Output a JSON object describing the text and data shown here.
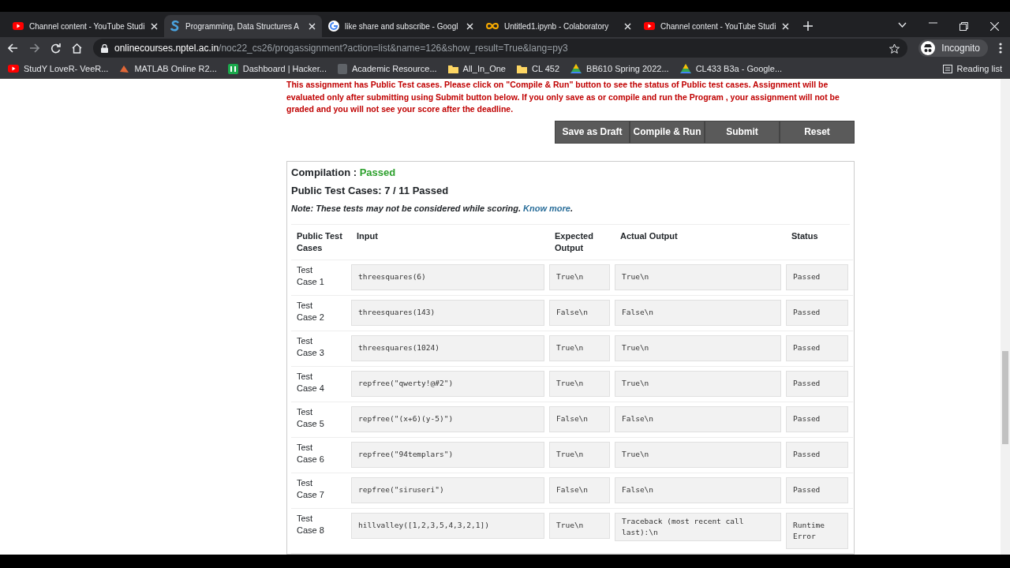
{
  "tabs": [
    {
      "kind": "youtube",
      "title": "Channel content - YouTube Studi",
      "selected": false
    },
    {
      "kind": "s",
      "title": "Programming, Data Structures A",
      "selected": true
    },
    {
      "kind": "google",
      "title": "like share and subscribe - Googl",
      "selected": false
    },
    {
      "kind": "colab",
      "title": "Untitled1.ipynb - Colaboratory",
      "selected": false
    },
    {
      "kind": "youtube",
      "title": "Channel content - YouTube Studi",
      "selected": false
    }
  ],
  "address": {
    "host": "onlinecourses.nptel.ac.in",
    "path": "/noc22_cs26/progassignment?action=list&name=126&show_result=True&lang=py3"
  },
  "profile": "Incognito",
  "bookmarks": [
    {
      "kind": "youtube",
      "label": "StudY LoveR- VeeR..."
    },
    {
      "kind": "matlab",
      "label": "MATLAB Online R2..."
    },
    {
      "kind": "hackerrank",
      "label": "Dashboard | Hacker..."
    },
    {
      "kind": "blank",
      "label": "Academic Resource..."
    },
    {
      "kind": "folder",
      "label": "All_In_One"
    },
    {
      "kind": "folder",
      "label": "CL 452"
    },
    {
      "kind": "drive",
      "label": "BB610 Spring 2022..."
    },
    {
      "kind": "drive",
      "label": "CL433 B3a - Google..."
    }
  ],
  "reading_list": "Reading list",
  "notice": "This assignment has Public Test cases. Please click on \"Compile & Run\" button to see the status of Public test cases. Assignment will be evaluated only after submitting using Submit button below. If you only save as or compile and run the Program , your assignment will not be graded and you will not see your score after the deadline.",
  "buttons": [
    "Save as Draft",
    "Compile & Run",
    "Submit",
    "Reset"
  ],
  "result": {
    "compilation_label": "Compilation :",
    "compilation_status": "Passed",
    "summary": "Public Test Cases: 7 / 11 Passed",
    "note": "Note: These tests may not be considered while scoring.",
    "note_link": "Know more",
    "note_end": "."
  },
  "table": {
    "columns": [
      "Public Test Cases",
      "Input",
      "Expected Output",
      "Actual Output",
      "Status"
    ],
    "rows": [
      {
        "case": "Test Case 1",
        "input": "threesquares(6)",
        "expected": "True\\n",
        "actual": "True\\n",
        "status": "Passed"
      },
      {
        "case": "Test Case 2",
        "input": "threesquares(143)",
        "expected": "False\\n",
        "actual": "False\\n",
        "status": "Passed"
      },
      {
        "case": "Test Case 3",
        "input": "threesquares(1024)",
        "expected": "True\\n",
        "actual": "True\\n",
        "status": "Passed"
      },
      {
        "case": "Test Case 4",
        "input": "repfree(\"qwerty!@#2\")",
        "expected": "True\\n",
        "actual": "True\\n",
        "status": "Passed"
      },
      {
        "case": "Test Case 5",
        "input": "repfree(\"(x+6)(y-5)\")",
        "expected": "False\\n",
        "actual": "False\\n",
        "status": "Passed"
      },
      {
        "case": "Test Case 6",
        "input": "repfree(\"94templars\")",
        "expected": "True\\n",
        "actual": "True\\n",
        "status": "Passed"
      },
      {
        "case": "Test Case 7",
        "input": "repfree(\"siruseri\")",
        "expected": "False\\n",
        "actual": "False\\n",
        "status": "Passed"
      },
      {
        "case": "Test Case 8",
        "input": "hillvalley([1,2,3,5,4,3,2,1])",
        "expected": "True\\n",
        "actual": "Traceback (most recent call last):\\n",
        "status": "Runtime Error"
      }
    ]
  }
}
